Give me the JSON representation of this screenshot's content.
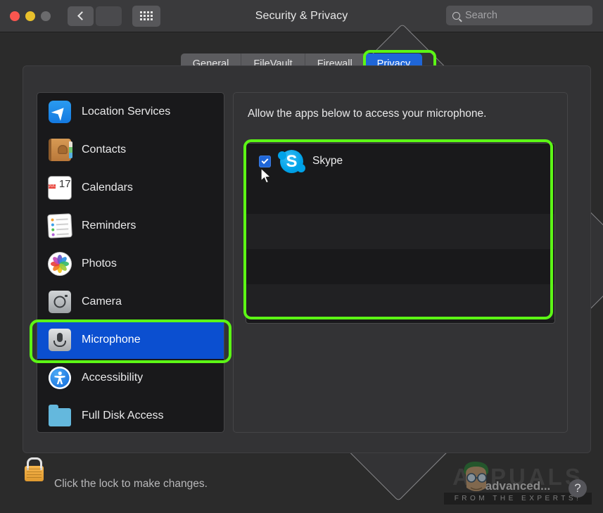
{
  "window": {
    "title": "Security & Privacy",
    "traffic_lights": [
      "close",
      "minimize",
      "zoom"
    ],
    "nav": {
      "back_label": "‹",
      "forward_label": "›"
    },
    "grid_button": "show-all-preferences"
  },
  "search": {
    "placeholder": "Search",
    "value": "",
    "icon": "search-icon"
  },
  "tabs": [
    {
      "label": "General",
      "active": false
    },
    {
      "label": "FileVault",
      "active": false
    },
    {
      "label": "Firewall",
      "active": false
    },
    {
      "label": "Privacy",
      "active": true
    }
  ],
  "sidebar": {
    "items": [
      {
        "label": "Location Services",
        "icon": "location-services-icon",
        "selected": false
      },
      {
        "label": "Contacts",
        "icon": "contacts-icon",
        "selected": false
      },
      {
        "label": "Calendars",
        "icon": "calendars-icon",
        "selected": false
      },
      {
        "label": "Reminders",
        "icon": "reminders-icon",
        "selected": false
      },
      {
        "label": "Photos",
        "icon": "photos-icon",
        "selected": false
      },
      {
        "label": "Camera",
        "icon": "camera-icon",
        "selected": false
      },
      {
        "label": "Microphone",
        "icon": "microphone-icon",
        "selected": true
      },
      {
        "label": "Accessibility",
        "icon": "accessibility-icon",
        "selected": false
      },
      {
        "label": "Full Disk Access",
        "icon": "folder-icon",
        "selected": false
      }
    ],
    "calendar_icon": {
      "month": "JUL",
      "day": "17"
    }
  },
  "main": {
    "heading": "Allow the apps below to access your microphone.",
    "apps": [
      {
        "name": "Skype",
        "checked": true,
        "icon": "skype-icon",
        "initial": "S"
      }
    ]
  },
  "footer": {
    "lock_icon": "lock-closed-icon",
    "lock_text": "Click the lock to make changes.",
    "help_label": "?"
  },
  "watermark": {
    "brand": "APPUALS",
    "overlay": "advanced...",
    "tagline": "FROM THE EXPERTS!"
  },
  "annotations": {
    "color": "#5cf615",
    "targets": [
      "privacy-tab",
      "microphone-sidebar-item",
      "app-list"
    ]
  },
  "colors": {
    "accent_blue": "#1f66d8",
    "selected_blue": "#0b4fd0",
    "window_bg": "#2b2b2b",
    "panel_bg": "#333335",
    "list_bg": "#19191b",
    "annotation_green": "#5cf615",
    "lock_orange": "#f5b44c"
  }
}
